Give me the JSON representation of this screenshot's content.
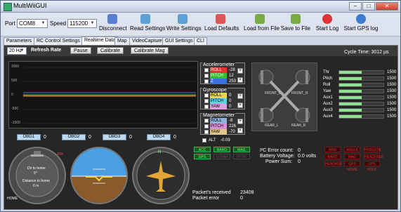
{
  "window": {
    "title": "MultiWiiGUI",
    "min": "–",
    "max": "□",
    "close": "✕"
  },
  "toolbar": {
    "port_label": "Port",
    "port_value": "COM8",
    "speed_label": "Speed",
    "speed_value": "115200",
    "buttons": [
      {
        "label": "Disconnect",
        "icon": "satellite-dish-icon",
        "color": "#5a7fd0"
      },
      {
        "label": "Read Settings",
        "icon": "read-settings-icon",
        "color": "#5da0d6"
      },
      {
        "label": "Write Settings",
        "icon": "write-settings-icon",
        "color": "#5da0d6"
      },
      {
        "label": "Load Defaults",
        "icon": "load-defaults-icon",
        "color": "#d55"
      },
      {
        "label": "Load from File",
        "icon": "file-icon",
        "color": "#7aaa44"
      },
      {
        "label": "Save to File",
        "icon": "file-icon",
        "color": "#7aaa44"
      },
      {
        "label": "Start Log",
        "icon": "record-icon",
        "color": "#d33"
      },
      {
        "label": "Start GPS log",
        "icon": "globe-icon",
        "color": "#3b7bd1"
      }
    ]
  },
  "tabs": [
    {
      "label": "Parameters"
    },
    {
      "label": "RC Control Settings"
    },
    {
      "label": "Realtime Data"
    },
    {
      "label": "Map"
    },
    {
      "label": "VideoCapture"
    },
    {
      "label": "GUI Settings"
    },
    {
      "label": "CLI"
    }
  ],
  "active_tab": "Realtime Data",
  "realtime": {
    "rate_value": "20 Hz",
    "refresh_label": "Refresh Rate",
    "pause_label": "Pause",
    "calibrate_label": "Calibrate",
    "calibrate_mag_label": "Calibrate Mag",
    "cycle_time": "Cycle Time:  3012 µs",
    "graph_ticks": [
      "1000",
      "500",
      "0",
      "-500",
      "-1000"
    ]
  },
  "sensors": {
    "accelerometer": {
      "title": "Accelerometer",
      "rows": [
        {
          "name": "ROLL",
          "value": "-28",
          "color": "#e23131"
        },
        {
          "name": "PITCH",
          "value": "12",
          "color": "#2fbf2f"
        },
        {
          "name": "Z",
          "value": "253",
          "color": "#3c6fe0"
        }
      ]
    },
    "gyroscope": {
      "title": "Gyroscope",
      "rows": [
        {
          "name": "ROLL",
          "value": "0",
          "color": "#e6d84d"
        },
        {
          "name": "PITCH",
          "value": "0",
          "color": "#54d9e1"
        },
        {
          "name": "YAW",
          "value": "0",
          "color": "#d9a1e0"
        }
      ]
    },
    "magnetometer": {
      "title": "Magnetometer",
      "rows": [
        {
          "name": "ROLL",
          "value": "-8",
          "color": "#8fb0d9"
        },
        {
          "name": "PITCH",
          "value": "226",
          "color": "#d98fd9"
        },
        {
          "name": "YAW",
          "value": "-70",
          "color": "#e0c58a"
        }
      ]
    },
    "alt": {
      "label": "ALT",
      "value": "-0.09"
    }
  },
  "motors": {
    "labels": [
      "FRONT_L",
      "FRONT_R",
      "REAR_L",
      "REAR_R"
    ]
  },
  "rc": [
    {
      "name": "Thr",
      "value": "1500",
      "level": 0.5
    },
    {
      "name": "Pitch",
      "value": "1500",
      "level": 0.5
    },
    {
      "name": "Roll",
      "value": "1500",
      "level": 0.5
    },
    {
      "name": "Yaw",
      "value": "1500",
      "level": 0.5
    },
    {
      "name": "Aux1",
      "value": "1500",
      "level": 0.5
    },
    {
      "name": "Aux2",
      "value": "1500",
      "level": 0.5
    },
    {
      "name": "Aux3",
      "value": "1500",
      "level": 0.5
    },
    {
      "name": "Aux4",
      "value": "1500",
      "level": 0.5
    }
  ],
  "debug": [
    {
      "label": "DBG1",
      "value": "0"
    },
    {
      "label": "DBG2",
      "value": "0"
    },
    {
      "label": "DBG3",
      "value": "0"
    },
    {
      "label": "DBG4",
      "value": "0"
    }
  ],
  "gauges": {
    "home_distance_label": "Dir to home",
    "home_dir_value": "0°",
    "distance_label": "Distance to home",
    "distance_value": "0 m",
    "home_label": "HOME",
    "fix_label": "FIX",
    "compass_north": "N"
  },
  "status_leds": [
    {
      "label": "ACC",
      "on": true
    },
    {
      "label": "BARO",
      "on": true
    },
    {
      "label": "MAG",
      "on": true
    },
    {
      "label": "GPS",
      "on": true
    },
    {
      "label": "SONAR",
      "on": false
    },
    {
      "label": "OPTIC",
      "on": false
    }
  ],
  "stats": {
    "i2c_error_label": "I²C Error count:",
    "i2c_error_value": "0",
    "battery_label": "Battery Voltage:",
    "battery_value": "0.0 volts",
    "power_label": "Power Sum:",
    "power_value": "0",
    "packet_received_label": "Packet's received",
    "packet_received_value": "23408",
    "packet_error_label": "Packet error",
    "packet_error_value": "0"
  },
  "flight_modes": [
    "ARM",
    "ANGLE",
    "HORIZON",
    "BARO",
    "MAG",
    "HEADFREE",
    "HEADADJ",
    "GPS HOME",
    "GPS HOLD"
  ]
}
